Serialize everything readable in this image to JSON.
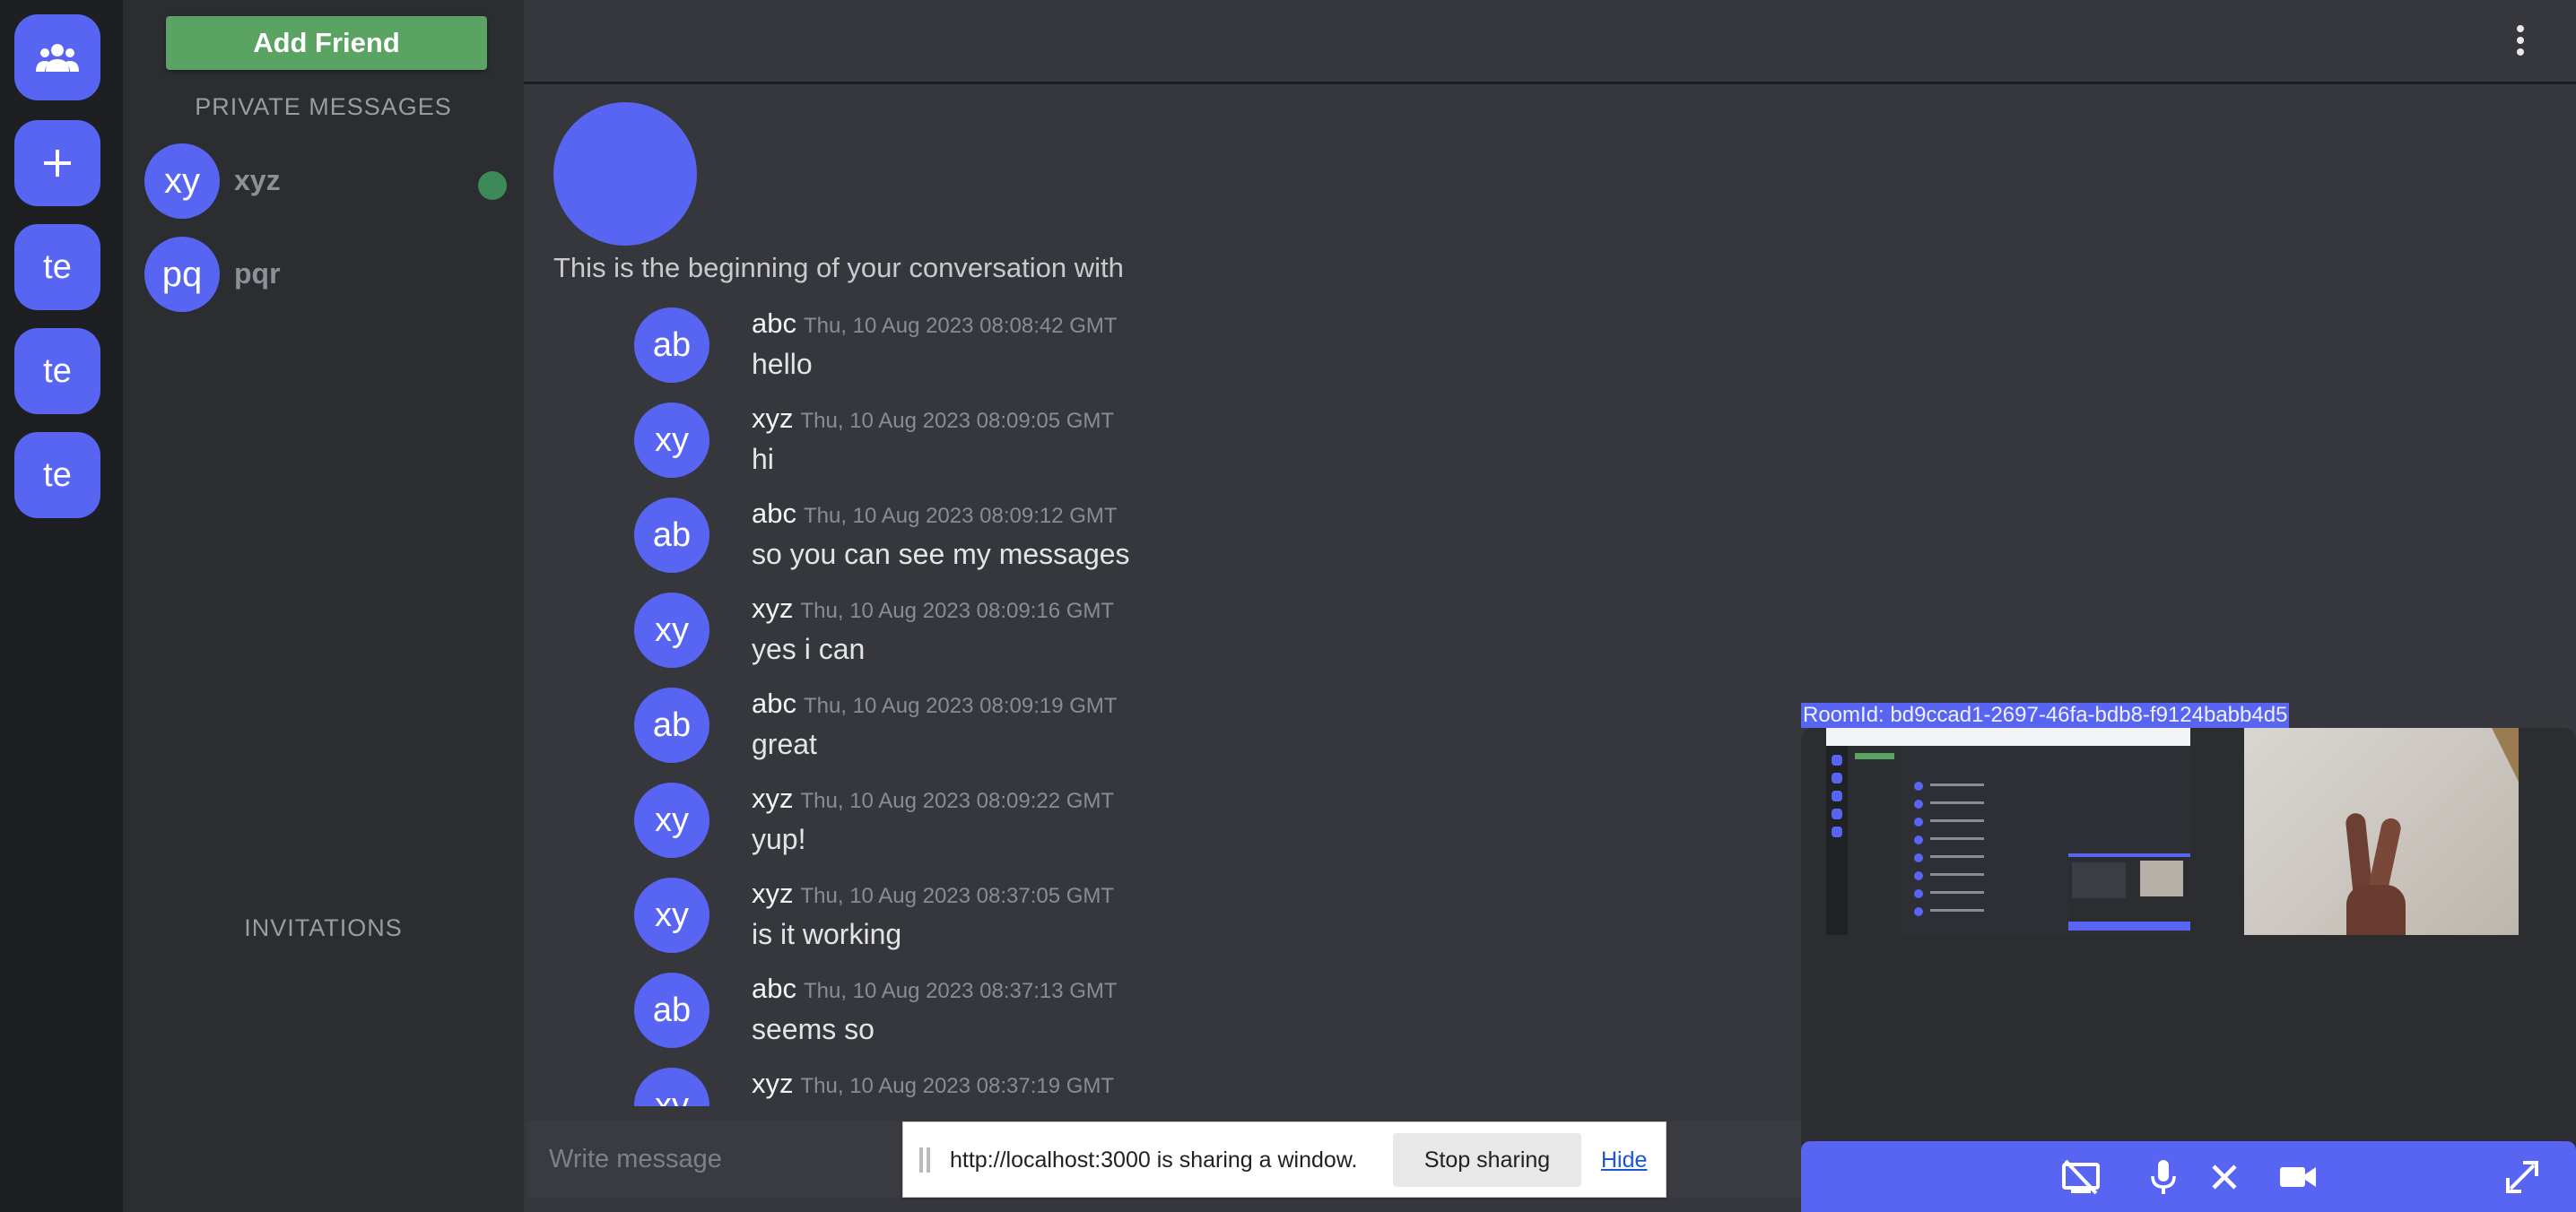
{
  "servers": [
    "te",
    "te",
    "te"
  ],
  "friends_panel": {
    "add_friend_label": "Add Friend",
    "private_messages_heading": "PRIVATE MESSAGES",
    "invitations_heading": "INVITATIONS",
    "dms": [
      {
        "initials": "xy",
        "name": "xyz",
        "online": true
      },
      {
        "initials": "pq",
        "name": "pqr",
        "online": false
      }
    ]
  },
  "chat": {
    "intro": "This is the beginning of your conversation with",
    "messages": [
      {
        "initials": "ab",
        "author": "abc",
        "time": "Thu, 10 Aug 2023 08:08:42 GMT",
        "text": "hello"
      },
      {
        "initials": "xy",
        "author": "xyz",
        "time": "Thu, 10 Aug 2023 08:09:05 GMT",
        "text": "hi"
      },
      {
        "initials": "ab",
        "author": "abc",
        "time": "Thu, 10 Aug 2023 08:09:12 GMT",
        "text": "so you can see my messages"
      },
      {
        "initials": "xy",
        "author": "xyz",
        "time": "Thu, 10 Aug 2023 08:09:16 GMT",
        "text": "yes i can"
      },
      {
        "initials": "ab",
        "author": "abc",
        "time": "Thu, 10 Aug 2023 08:09:19 GMT",
        "text": "great"
      },
      {
        "initials": "xy",
        "author": "xyz",
        "time": "Thu, 10 Aug 2023 08:09:22 GMT",
        "text": "yup!"
      },
      {
        "initials": "xy",
        "author": "xyz",
        "time": "Thu, 10 Aug 2023 08:37:05 GMT",
        "text": "is it working"
      },
      {
        "initials": "ab",
        "author": "abc",
        "time": "Thu, 10 Aug 2023 08:37:13 GMT",
        "text": "seems so"
      },
      {
        "initials": "xy",
        "author": "xyz",
        "time": "Thu, 10 Aug 2023 08:37:19 GMT",
        "text": ""
      }
    ],
    "composer_placeholder": "Write message"
  },
  "share_bar": {
    "text": "http://localhost:3000 is sharing a window.",
    "stop_label": "Stop sharing",
    "hide_label": "Hide"
  },
  "room": {
    "room_id_text": "RoomId: bd9ccad1-2697-46fa-bdb8-f9124babb4d5"
  },
  "icons": {
    "rail": [
      "group-icon",
      "plus-icon"
    ],
    "topbar": [
      "more-vert-icon"
    ],
    "call_controls": [
      "screen-share-off-icon",
      "mic-icon",
      "close-icon",
      "videocam-icon",
      "fullscreen-icon"
    ]
  },
  "colors": {
    "accent": "#5865f2",
    "add_friend": "#5ba362",
    "online": "#3d8a58"
  }
}
